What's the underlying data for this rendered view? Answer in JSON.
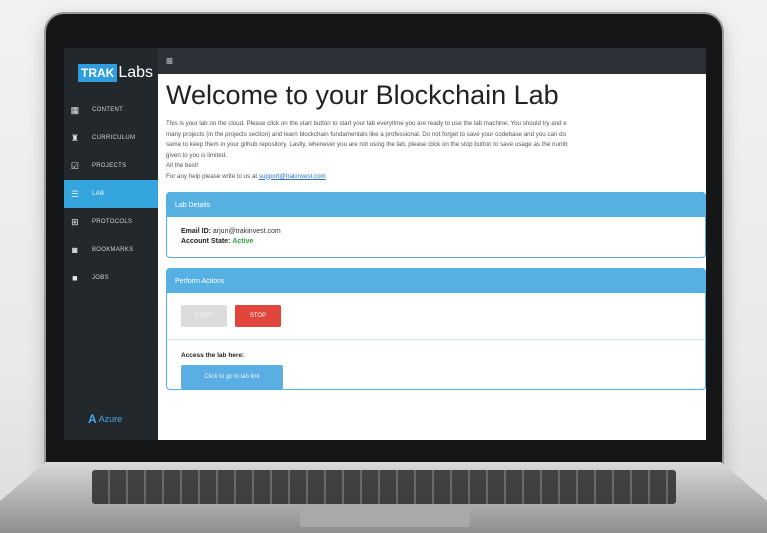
{
  "brand": {
    "trak": "TRAK",
    "labs": "Labs"
  },
  "sidebar": {
    "items": [
      {
        "label": "CONTENT",
        "icon": "dashboard-icon"
      },
      {
        "label": "CURRICULUM",
        "icon": "graduation-icon"
      },
      {
        "label": "PROJECTS",
        "icon": "checkbox-icon"
      },
      {
        "label": "LAB",
        "icon": "list-icon",
        "active": true
      },
      {
        "label": "PROTOCOLS",
        "icon": "grid-icon"
      },
      {
        "label": "BOOKMARKS",
        "icon": "user-icon"
      },
      {
        "label": "JOBS",
        "icon": "briefcase-icon"
      }
    ],
    "footer": "Azure"
  },
  "main": {
    "title": "Welcome to your Blockchain Lab",
    "intro_lines": [
      "This is your lab on the cloud. Please click on the start button to start your lab everytime you are ready to use the lab machine. You should try and e",
      "many projects (in the projects section) and learn blockchain fundamentals like a professional. Do not forget to save your codebase and you can do",
      "same to keep them in your github repository. Lastly, whenever you are not using the lab, please click on the stop button to save usage as the numb",
      "given to you is limited.",
      "All the best!"
    ],
    "help_text": "For any help please write to us at",
    "help_email": "support@trakinvest.com"
  },
  "lab_details": {
    "header": "Lab Details",
    "email_label": "Email ID:",
    "email_value": "arjun@trakinvest.com",
    "state_label": "Account State:",
    "state_value": "Active"
  },
  "actions": {
    "header": "Perform Actions",
    "start": "START",
    "stop": "STOP",
    "access_label": "Access the lab here:",
    "open_button": "Click to go to lab link"
  }
}
